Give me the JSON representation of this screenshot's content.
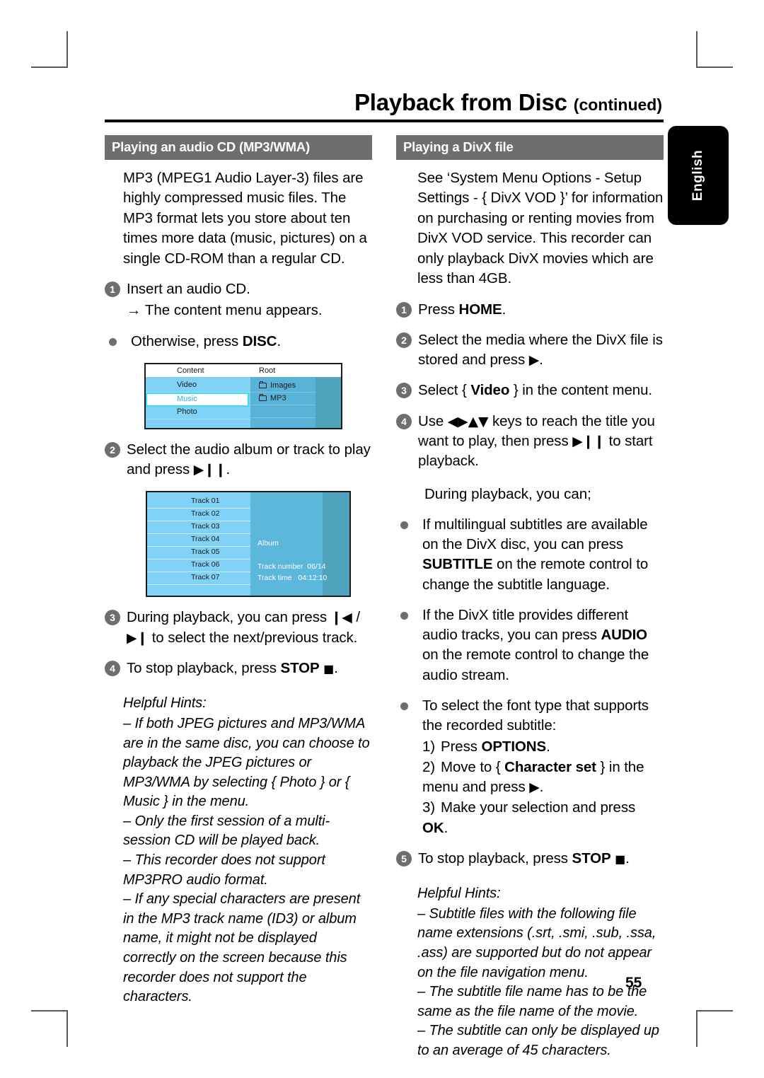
{
  "document": {
    "title_main": "Playback from Disc",
    "title_suffix": "(continued)",
    "page_number": "55",
    "language_tab": "English"
  },
  "left_column": {
    "section_header": "Playing an audio CD (MP3/WMA)",
    "intro": "MP3 (MPEG1 Audio Layer-3) files are highly compressed music files.  The MP3 format lets you store about ten times more data (music, pictures) on a single CD-ROM than a regular CD.",
    "step1": {
      "num": "1",
      "text": "Insert an audio CD.",
      "arrow_note": "→ The content menu appears."
    },
    "bullet_otherwise": {
      "prefix": "Otherwise, press ",
      "key": "DISC",
      "suffix": "."
    },
    "content_menu_shot": {
      "col1_header": "Content",
      "col2_header": "Root",
      "left_items": [
        "Video",
        "Music",
        "Photo"
      ],
      "selected_item": "Music",
      "right_items": [
        "Images",
        "MP3"
      ]
    },
    "step2": {
      "num": "2",
      "text_before": "Select the audio album or track to play and press ",
      "glyph": "▶❙❙",
      "text_after": "."
    },
    "track_shot": {
      "tracks": [
        "Track 01",
        "Track 02",
        "Track 03",
        "Track 04",
        "Track 05",
        "Track 06",
        "Track 07"
      ],
      "album_label": "Album",
      "track_number_label": "Track number",
      "track_number_value": "06/14",
      "track_time_label": "Track time",
      "track_time_value": "04:12:10"
    },
    "step3": {
      "num": "3",
      "text_before": "During playback, you can press ",
      "glyph_prev": "❙◀",
      "separator": " / ",
      "glyph_next": "▶❙",
      "text_after": " to select the next/previous track."
    },
    "step4": {
      "num": "4",
      "text_before": "To stop playback, press ",
      "key": "STOP",
      "glyph": "■",
      "text_after": "."
    },
    "hints": {
      "title": "Helpful Hints:",
      "items": [
        "– If both JPEG pictures and MP3/WMA are in the same disc, you can choose to playback the JPEG pictures or MP3/WMA by selecting { Photo } or { Music } in the menu.",
        "– Only the first session of a multi-session CD will be played back.",
        "– This recorder does not support MP3PRO audio format.",
        "– If any special characters are present in the MP3 track name (ID3) or album name, it might not be displayed correctly on the screen because this recorder does not support the characters."
      ]
    }
  },
  "right_column": {
    "section_header": "Playing a DivX file",
    "intro": "See ‘System Menu Options - Setup Settings - { DivX VOD }’ for information on purchasing or renting movies from DivX VOD service. This recorder can only playback DivX movies which are less than 4GB.",
    "step1": {
      "num": "1",
      "text_before": "Press ",
      "key": "HOME",
      "text_after": "."
    },
    "step2": {
      "num": "2",
      "text_before": "Select the media where the DivX file is stored and press ",
      "glyph": "▶",
      "text_after": "."
    },
    "step3": {
      "num": "3",
      "text_before": "Select { ",
      "key": "Video",
      "text_after": " } in the content menu."
    },
    "step4": {
      "num": "4",
      "text_before": "Use ",
      "glyphs": "◀▶▲▼",
      "text_mid": " keys to reach the title you want to play, then press ",
      "glyph_play": "▶❙❙",
      "text_after": " to start playback."
    },
    "during_playback": "During playback, you can;",
    "bullet_subtitle": {
      "text_before": "If multilingual subtitles are available on the DivX disc, you can press ",
      "key": "SUBTITLE",
      "text_after": " on the remote control to change the subtitle language."
    },
    "bullet_audio": {
      "text_before": "If the DivX title provides different audio tracks, you can press ",
      "key": "AUDIO",
      "text_after": " on the remote control to change the audio stream."
    },
    "bullet_font": {
      "text": "To select the font type that supports the recorded subtitle:",
      "sub1_label": "1)",
      "sub1_before": "Press ",
      "sub1_key": "OPTIONS",
      "sub1_after": ".",
      "sub2_label": "2)",
      "sub2_before": "Move to { ",
      "sub2_key": "Character set",
      "sub2_after": " } in the menu and press ",
      "sub2_glyph": "▶",
      "sub2_end": ".",
      "sub3_label": "3)",
      "sub3_before": "Make your selection and press ",
      "sub3_key": "OK",
      "sub3_after": "."
    },
    "step5": {
      "num": "5",
      "text_before": "To stop playback, press ",
      "key": "STOP",
      "glyph": "■",
      "text_after": "."
    },
    "hints": {
      "title": "Helpful Hints:",
      "items": [
        "– Subtitle files with the following file name extensions (.srt, .smi, .sub, .ssa, .ass) are supported but do not appear on the file navigation menu.",
        "– The subtitle file name has to be the same as the file name of the movie.",
        "– The subtitle can only be displayed up to an average of 45 characters."
      ]
    }
  },
  "colors": {
    "section_header_bg": "#6e6e6e",
    "ui_light_blue": "#7fd2f6",
    "ui_mid_blue": "#57b4d8",
    "ui_dark_blue": "#4fa3bd",
    "selection_border": "#35dff0",
    "tab_bg": "#000000"
  }
}
